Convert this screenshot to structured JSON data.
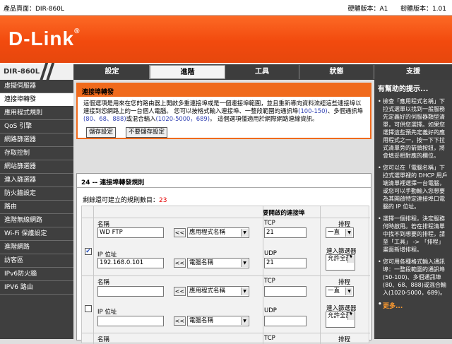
{
  "topbar": {
    "product": "產品頁面：DIR-860L",
    "hw": "硬體版本：A1",
    "fw": "韌體版本：1.01"
  },
  "brand": {
    "logo": "D-Link",
    "model": "DIR-860L"
  },
  "tabs": [
    {
      "label": "設定"
    },
    {
      "label": "進階"
    },
    {
      "label": "工具"
    },
    {
      "label": "狀態"
    },
    {
      "label": "支援"
    }
  ],
  "sidebar": {
    "items": [
      {
        "label": "虛擬伺服器"
      },
      {
        "label": "連接埠轉發"
      },
      {
        "label": "應用程式規則"
      },
      {
        "label": "QoS 引擎"
      },
      {
        "label": "網路篩選器"
      },
      {
        "label": "存取控制"
      },
      {
        "label": "網站篩選器"
      },
      {
        "label": "連入篩選器"
      },
      {
        "label": "防火牆設定"
      },
      {
        "label": "路由"
      },
      {
        "label": "進階無線網路"
      },
      {
        "label": "Wi-Fi 保護設定"
      },
      {
        "label": "進階網路"
      },
      {
        "label": "訪客區"
      },
      {
        "label": "IPv6防火牆"
      },
      {
        "label": "IPV6 路由"
      }
    ]
  },
  "section": {
    "title": "連接埠轉發",
    "desc1": "這個選項是用來在您的路由器上開啟多重連接埠或是一個連接埠範圍，並且重新導向資料流經這些連接埠以連接到您網路上的一台個人電腦。 您可以按格式輸入連接埠、一整段範圍的通訊埠",
    "desc_range": "(100-150)",
    "desc2": "、多個通訊埠",
    "desc_multi": "(80、68、888)",
    "desc3": "或混合輸入",
    "desc_mix": "(1020-5000，689)",
    "desc4": "。 這個選項僅適用於網際網路連線資訊。",
    "save": "儲存設定",
    "nosave": "不要儲存設定"
  },
  "rules": {
    "title": "24 -- 連接埠轉發規則",
    "count_label": "剩餘還可建立的規則數目：",
    "count": "23",
    "col_ports": "要開啟的連接埠",
    "name_label": "名稱",
    "ip_label": "IP 位址",
    "tcp_label": "TCP",
    "udp_label": "UDP",
    "schedule_label": "排程",
    "filter_label": "連入篩選器",
    "app_select": "應用程式名稱",
    "pc_select": "電腦名稱",
    "arrow": "<<",
    "schedule_value": "一直",
    "filter_value": "允許全部",
    "rows": [
      {
        "checked": true,
        "name": "WD FTP",
        "ip": "192.168.0.101",
        "tcp": "21",
        "udp": "21"
      },
      {
        "checked": false,
        "name": "",
        "ip": "",
        "tcp": "",
        "udp": ""
      },
      {
        "checked": false,
        "name": "",
        "ip": "",
        "tcp": "",
        "udp": ""
      }
    ]
  },
  "help": {
    "title": "有幫助的提示...",
    "p1": "檢查「應用程式名稱」下拉式選單以找到一般服務先定義好的伺服器類型清單，可供您選擇。如果您選擇這些預先定義好的應用程式之一，按一下下拉式清單旁的箭頭按鈕，將會填妥相對應的欄位。",
    "p2": "您可以在「電腦名稱」下拉式選單裡的 DHCP 用戶端清單裡選擇一台電腦，或您可以手動輸入您想要為其開啟特定連接埠口電腦的 IP 位址。",
    "p3": "選擇一個排程，決定服務何時啟用。若在排程清單中找不到想要的排程，請至「工具」 -> 「排程」畫面新增排程。",
    "p4": "您可用各種格式輸入通訊埠：一整段範圍的通訊埠(50-100)、多個通訊埠(80、68、888)或混合輸入(1020-5000，689)。",
    "more": "更多..."
  },
  "colors": {
    "orange": "#f06a1c",
    "dark": "#3f3f3f",
    "count": "#e60000",
    "link": "#3343b3",
    "more": "#ff9b2f"
  }
}
